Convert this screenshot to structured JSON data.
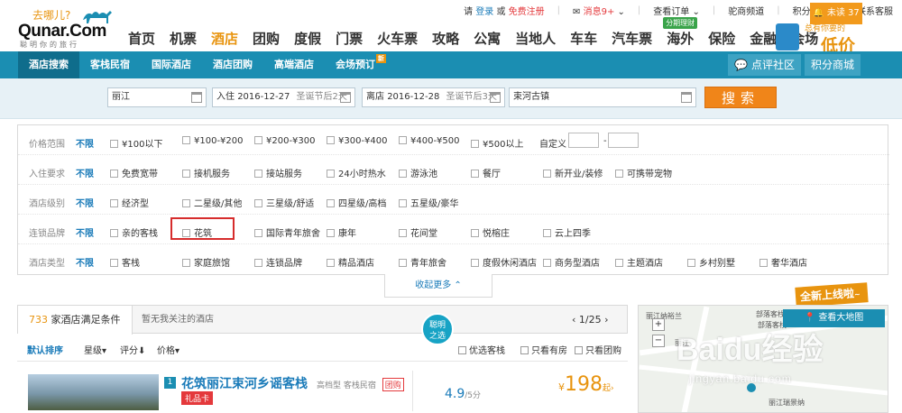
{
  "logo": {
    "slogan": "去哪儿?",
    "brand": "Qunar.Com",
    "tagline": "聪明你的旅行"
  },
  "topbar": {
    "please": "请",
    "login": "登录",
    "or": "或",
    "register": "免费注册",
    "messages": "消息9+",
    "orders": "查看订单",
    "merchant": "驼商频道",
    "points": "积分商城",
    "contact": "联系客服"
  },
  "nav": {
    "items": [
      "首页",
      "机票",
      "酒店",
      "团购",
      "度假",
      "门票",
      "火车票",
      "攻略",
      "公寓",
      "当地人",
      "车车",
      "汽车票",
      "海外",
      "保险",
      "金融",
      "会场"
    ],
    "active_index": 2,
    "haiwai_tag": "分期理财"
  },
  "ad": {
    "line1": "总有你要的",
    "line2": "低价"
  },
  "subnav": {
    "tabs": [
      "酒店搜索",
      "客栈民宿",
      "国际酒店",
      "酒店团购",
      "高端酒店",
      "会场预订"
    ],
    "active_index": 0,
    "new_badge": "新",
    "comment": "点评社区",
    "mall": "积分商城",
    "unread": "未读 37"
  },
  "search": {
    "city": "丽江",
    "checkin_label": "入住",
    "checkin_date": "2016-12-27",
    "checkin_hint": "圣诞节后2天",
    "checkout_label": "离店",
    "checkout_date": "2016-12-28",
    "checkout_hint": "圣诞节后3天",
    "keyword": "束河古镇",
    "button": "搜索"
  },
  "filters": {
    "unlimited": "不限",
    "rows": [
      {
        "label": "价格范围",
        "options": [
          "¥100以下",
          "¥100-¥200",
          "¥200-¥300",
          "¥300-¥400",
          "¥400-¥500",
          "¥500以上"
        ],
        "custom": "自定义",
        "dash": "-"
      },
      {
        "label": "入住要求",
        "options": [
          "免费宽带",
          "接机服务",
          "接站服务",
          "24小时热水",
          "游泳池",
          "餐厅",
          "新开业/装修",
          "可携带宠物"
        ]
      },
      {
        "label": "酒店级别",
        "options": [
          "经济型",
          "二星级/其他",
          "三星级/舒适",
          "四星级/高档",
          "五星级/豪华"
        ]
      },
      {
        "label": "连锁品牌",
        "options": [
          "亲的客栈",
          "花筑",
          "国际青年旅舍",
          "康年",
          "花间堂",
          "悦榕庄",
          "云上四季"
        ]
      },
      {
        "label": "酒店类型",
        "options": [
          "客栈",
          "家庭旅馆",
          "连锁品牌",
          "精品酒店",
          "青年旅舍",
          "度假休闲酒店",
          "商务型酒店",
          "主题酒店",
          "乡村别墅",
          "奢华酒店"
        ]
      }
    ],
    "collapse": "收起更多"
  },
  "results": {
    "count": "733",
    "count_suffix": "家酒店满足条件",
    "tab2": "暂无我关注的酒店",
    "pager": "1/25",
    "badge_line1": "聪明",
    "badge_line2": "之选",
    "sort": {
      "default": "默认排序",
      "star": "星级",
      "score": "评分",
      "price": "价格"
    },
    "checks": [
      "优选客栈",
      "只看有房",
      "只看团购"
    ]
  },
  "hotel": {
    "index": "1",
    "name": "花筑丽江束河乡谣客栈",
    "grade": "高档型",
    "type": "客栈民宿",
    "tuan": "团购",
    "gift": "礼品卡",
    "score": "4.9",
    "score_unit": "/5分",
    "currency": "¥",
    "price": "198",
    "price_suffix": "起"
  },
  "map": {
    "button": "查看大地图",
    "labels": [
      "丽江纳裕兰",
      "部落客栈",
      "部落客栈",
      "丽江",
      "丽江瑞景纳"
    ]
  },
  "newtag": {
    "text": "全新上线啦",
    "tilde": "~"
  },
  "watermark": {
    "brand": "Baidu经验",
    "url": "jingyan.baidu.com"
  }
}
